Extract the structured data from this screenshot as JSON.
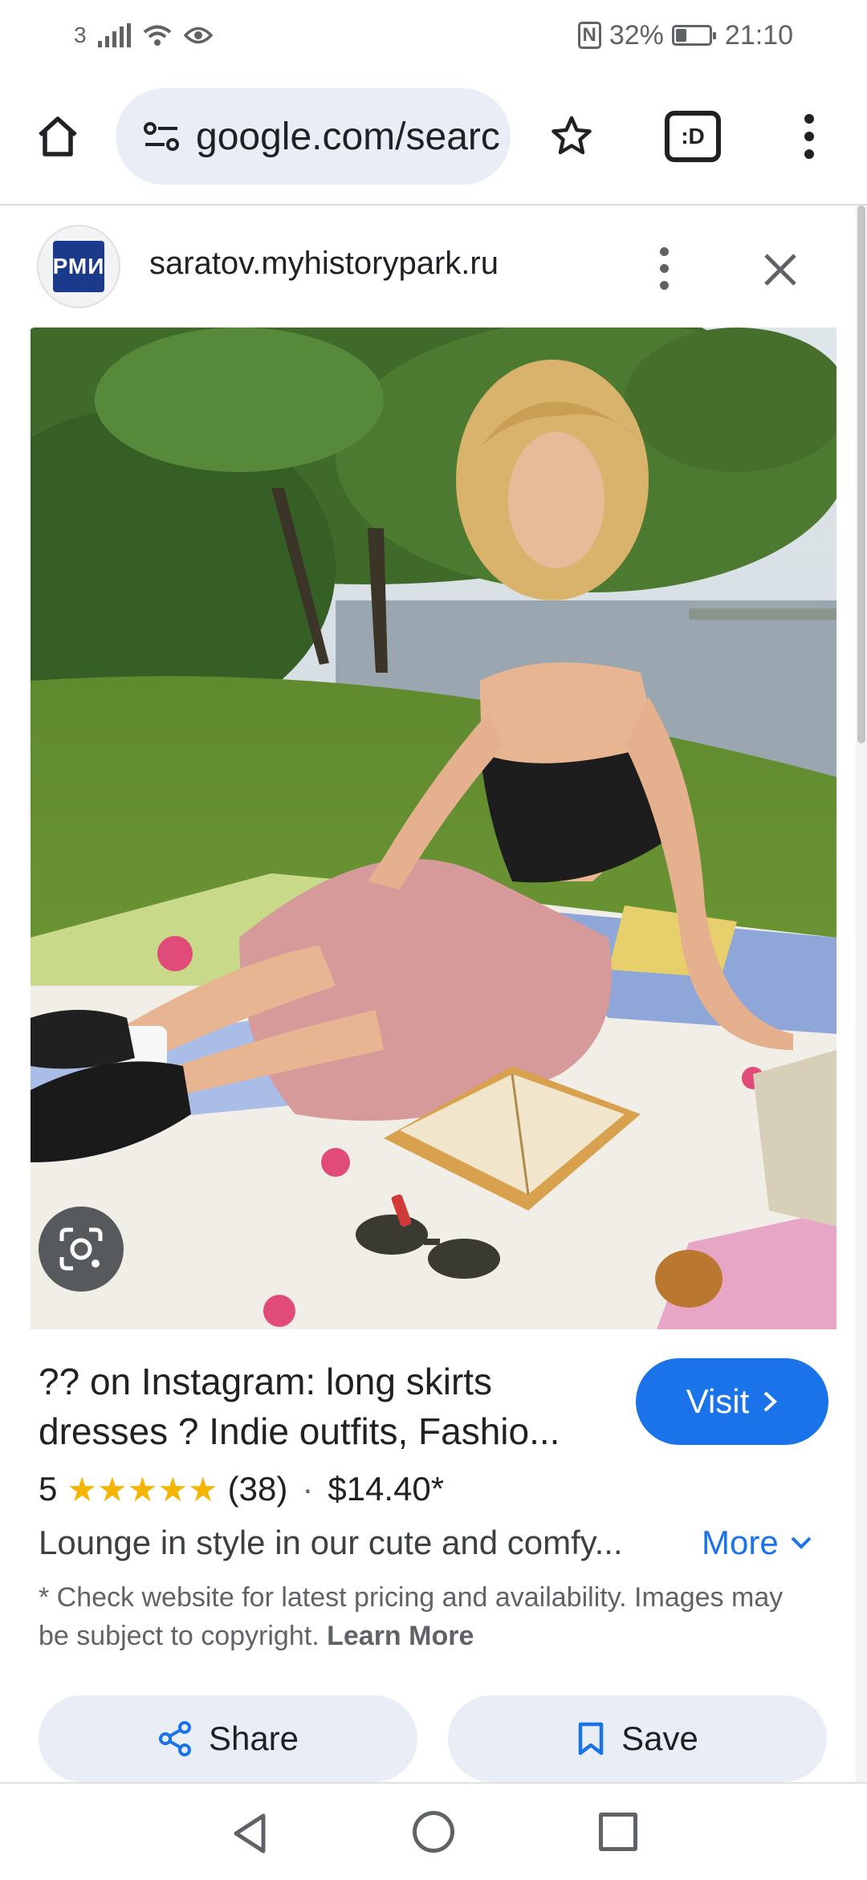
{
  "status_bar": {
    "sim_label": "3",
    "battery_percent": "32%",
    "battery_level": 0.32,
    "time": "21:10",
    "nfc_label": "N"
  },
  "toolbar": {
    "url": "google.com/searc",
    "tab_switcher_label": ":D",
    "icons": [
      "home-icon",
      "site-info-icon",
      "bookmark-star-icon",
      "tab-switcher-icon",
      "more-vert-icon"
    ]
  },
  "site": {
    "favicon_text": "РМИ",
    "domain": "saratov.myhistorypark.ru",
    "favicon_color": "#1b3a8c"
  },
  "result": {
    "title": "?? on Instagram: long skirts dresses ? Indie outfits, Fashio...",
    "visit_label": "Visit",
    "rating": "5",
    "stars": "★★★★★",
    "review_count": "(38)",
    "price": "$14.40*",
    "description": "Lounge in style in our cute and comfy...",
    "more_label": "More",
    "disclaimer": "* Check website for latest pricing and availability. Images may be subject to copyright.",
    "learn_more_label": "Learn More",
    "share_label": "Share",
    "save_label": "Save"
  },
  "colors": {
    "accent": "#1a73e8",
    "star": "#f4b400",
    "chip_bg": "#e9eef6"
  }
}
